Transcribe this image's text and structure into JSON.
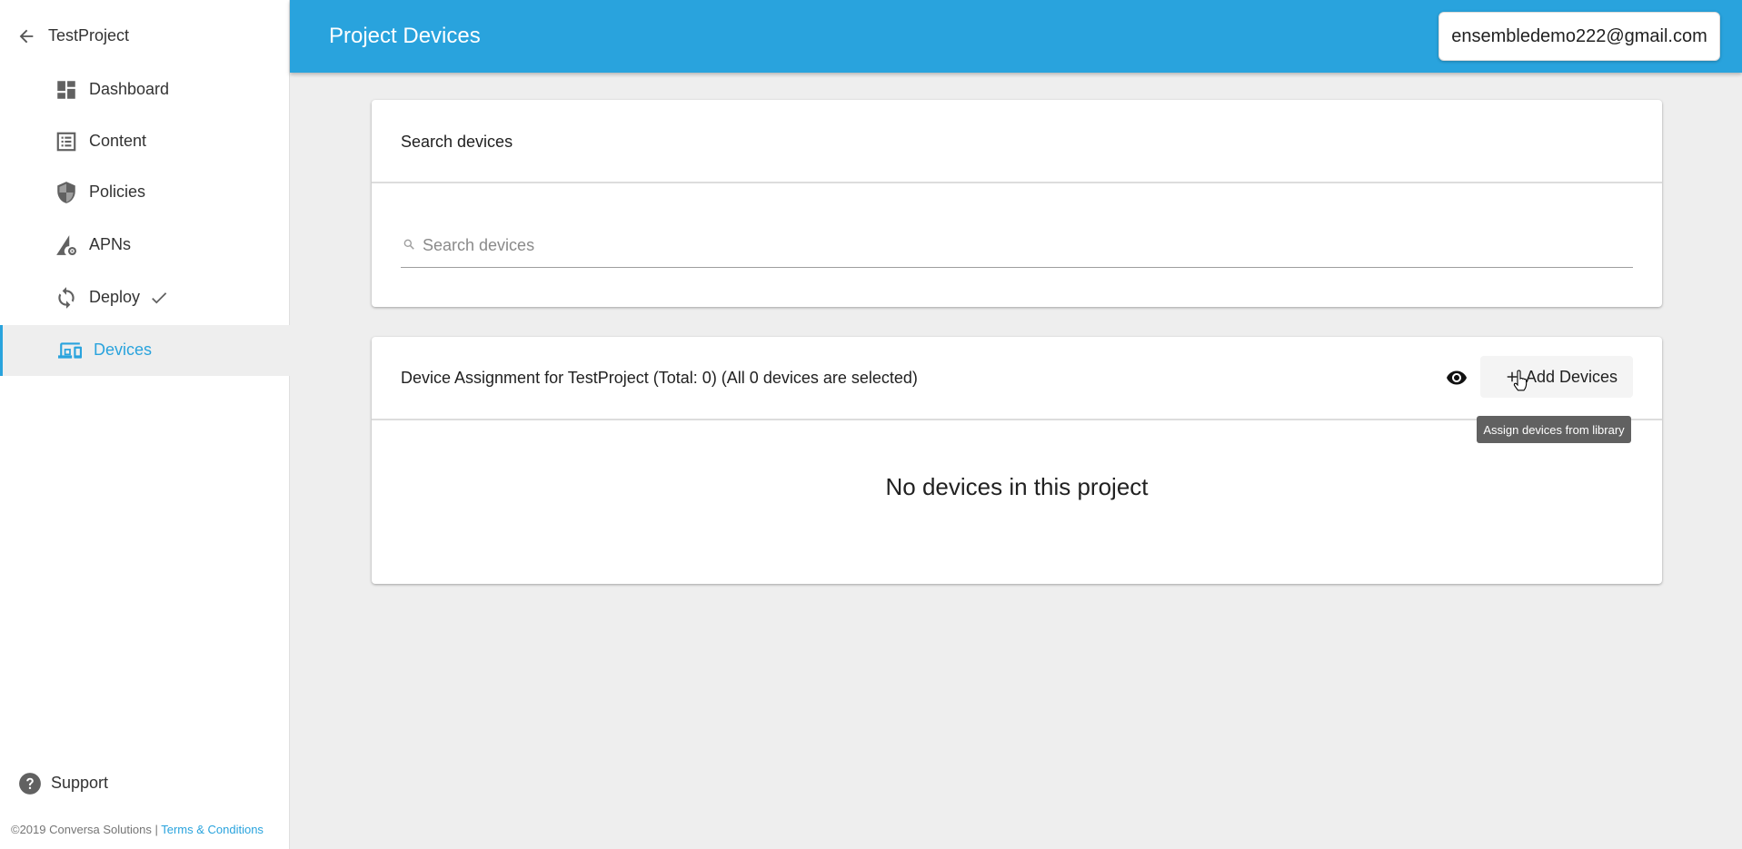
{
  "sidebar": {
    "back_label": "TestProject",
    "items": [
      {
        "label": "Dashboard",
        "icon": "dashboard-icon"
      },
      {
        "label": "Content",
        "icon": "list-icon"
      },
      {
        "label": "Policies",
        "icon": "shield-icon"
      },
      {
        "label": "APNs",
        "icon": "signal-settings-icon"
      },
      {
        "label": "Deploy",
        "icon": "sync-icon",
        "status_icon": "check-icon"
      },
      {
        "label": "Devices",
        "icon": "devices-icon",
        "active": true
      }
    ],
    "support_label": "Support",
    "footer": {
      "copyright": "©2019 Conversa Solutions | ",
      "terms_link": "Terms & Conditions"
    }
  },
  "header": {
    "title": "Project Devices",
    "user_email": "ensembledemo222@gmail.com"
  },
  "search_card": {
    "title": "Search devices",
    "placeholder": "Search devices",
    "value": ""
  },
  "devices_card": {
    "title": "Device Assignment for TestProject (Total: 0) (All 0 devices are selected)",
    "add_button_label": "Add Devices",
    "tooltip": "Assign devices from library",
    "empty_message": "No devices in this project"
  },
  "colors": {
    "accent": "#29a3dd",
    "background": "#eeeeee",
    "tooltip": "#616161"
  }
}
